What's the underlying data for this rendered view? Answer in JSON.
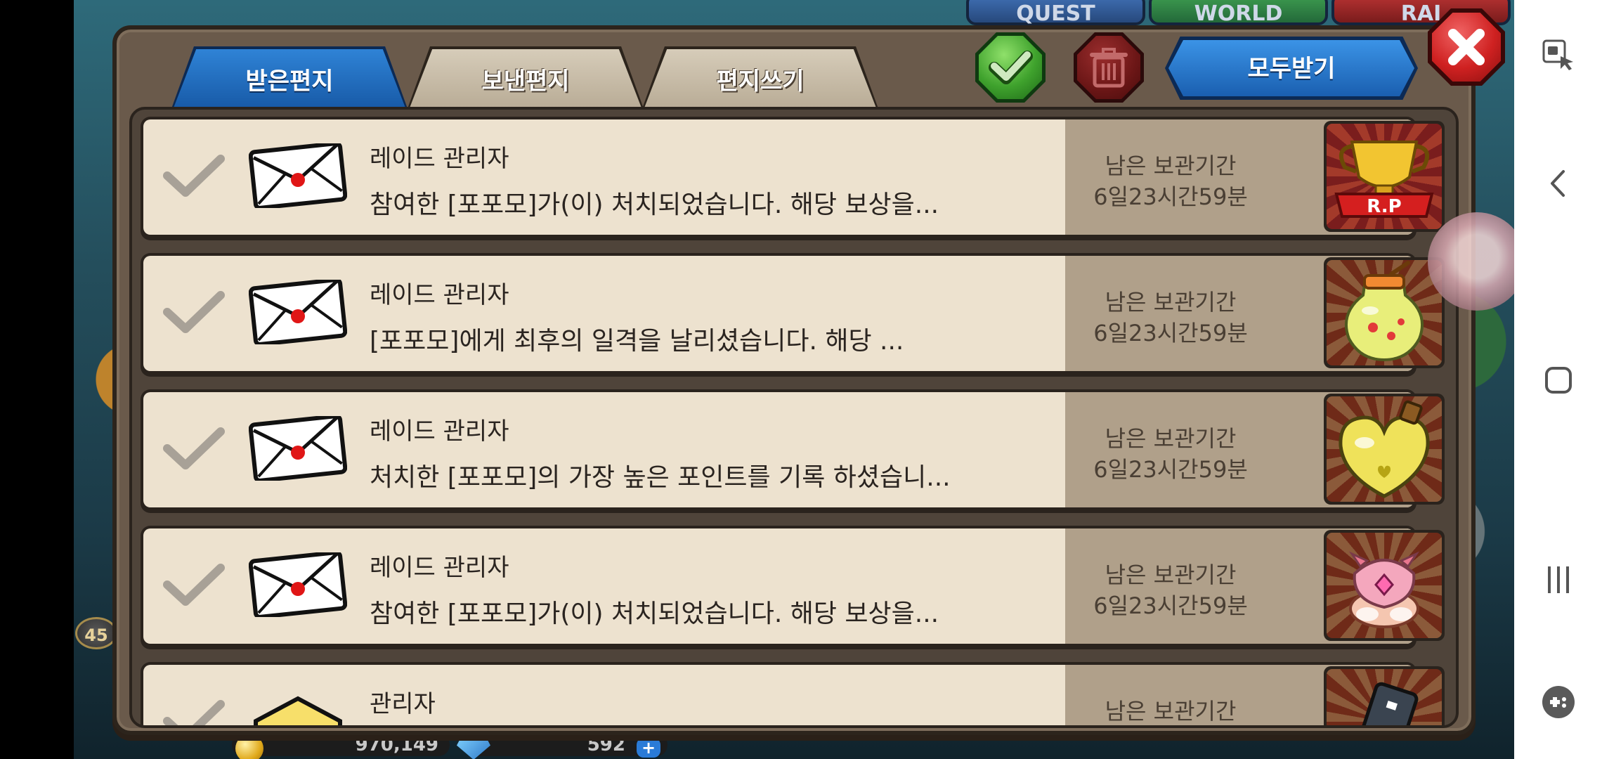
{
  "game": {
    "top_tabs": [
      "QUEST",
      "WORLD",
      "RAI"
    ],
    "gold": "970,149",
    "gems": "592",
    "level": "45"
  },
  "mailbox": {
    "tabs": [
      {
        "label": "받은편지",
        "active": true
      },
      {
        "label": "보낸편지",
        "active": false
      },
      {
        "label": "편지쓰기",
        "active": false
      }
    ],
    "receive_all_label": "모두받기",
    "rows": [
      {
        "sender": "레이드 관리자",
        "message": "참여한 [포포모]가(이) 처치되었습니다. 해당 보상을...",
        "retention_label": "남은 보관기간",
        "retention_value": "6일23시간59분",
        "reward_icon": "rp-trophy-icon",
        "reward_text": "R.P"
      },
      {
        "sender": "레이드 관리자",
        "message": "[포포모]에게 최후의 일격을 날리셨습니다. 해당 ...",
        "retention_label": "남은 보관기간",
        "retention_value": "6일23시간59분",
        "reward_icon": "potion-jar-icon"
      },
      {
        "sender": "레이드 관리자",
        "message": "처치한 [포포모]의 가장 높은 포인트를 기록 하셨습니...",
        "retention_label": "남은 보관기간",
        "retention_value": "6일23시간59분",
        "reward_icon": "heart-bottle-icon"
      },
      {
        "sender": "레이드 관리자",
        "message": "참여한 [포포모]가(이) 처치되었습니다. 해당 보상을...",
        "retention_label": "남은 보관기간",
        "retention_value": "6일23시간59분",
        "reward_icon": "pet-egg-icon"
      },
      {
        "sender": "관리자",
        "message": "",
        "retention_label": "남은 보관기간",
        "retention_value": "",
        "reward_icon": "item-card-icon"
      }
    ]
  },
  "colors": {
    "active_tab": "#1f6cc0",
    "inactive_tab": "#c9bda7",
    "row_background": "#ede2cf",
    "retention_panel": "#b0a08a",
    "close_red": "#cf2121",
    "select_green": "#3fa22d"
  }
}
